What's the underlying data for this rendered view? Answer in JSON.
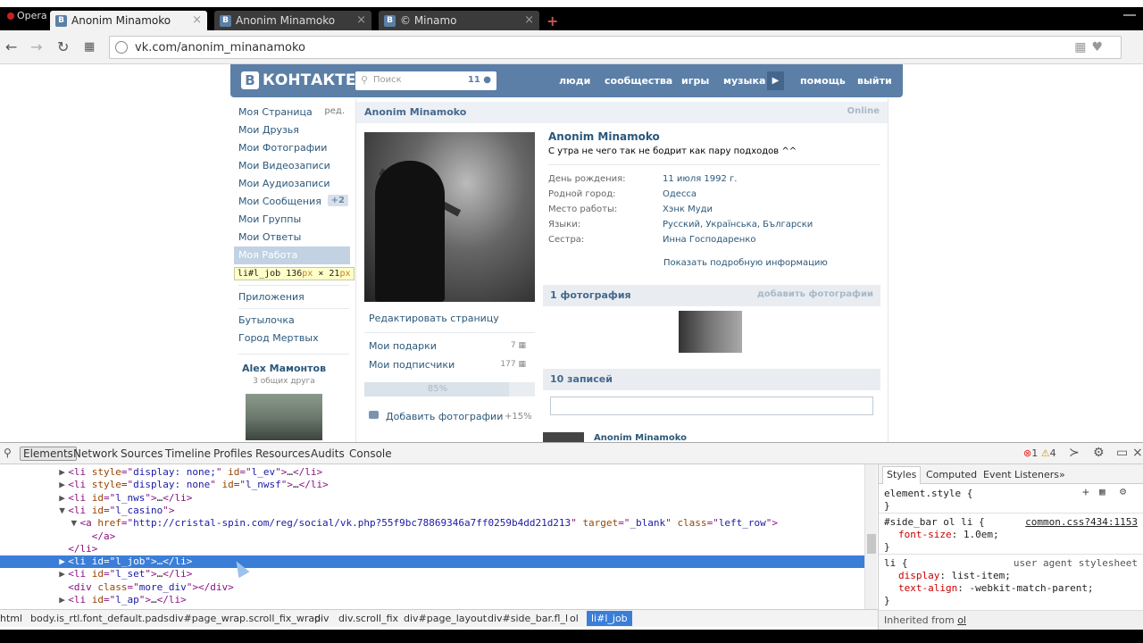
{
  "browser": {
    "opera_label": "Opera",
    "tabs": [
      {
        "title": "Anonim Minamoko",
        "favicon": "В"
      },
      {
        "title": "Anonim Minamoko",
        "favicon": "В"
      },
      {
        "title": "© Minamo",
        "favicon": "В"
      }
    ],
    "url": "vk.com/anonim_minanamoko"
  },
  "vk": {
    "logo": "КОНТАКТЕ",
    "logo_letter": "В",
    "search_placeholder": "Поиск",
    "search_count": "11",
    "menu": [
      "люди",
      "сообщества",
      "игры",
      "музыка",
      "помощь",
      "выйти"
    ],
    "sidebar": [
      {
        "label": "Моя Страница",
        "extra": "ред."
      },
      {
        "label": "Мои Друзья"
      },
      {
        "label": "Мои Фотографии"
      },
      {
        "label": "Мои Видеозаписи"
      },
      {
        "label": "Мои Аудиозаписи"
      },
      {
        "label": "Мои Сообщения",
        "badge": "+2"
      },
      {
        "label": "Мои Группы"
      },
      {
        "label": "Мои Ответы"
      },
      {
        "label": "Моя Работа"
      },
      {
        "label": "Приложения"
      },
      {
        "label": "Бутылочка"
      },
      {
        "label": "Город Мертвых"
      }
    ],
    "tooltip": {
      "sel": "li#l_job",
      "w": "136",
      "h": "21",
      "unit": "px",
      "times": "×"
    },
    "friend": {
      "name": "Alex Мамонтов",
      "sub": "3 общих друга"
    },
    "profile": {
      "header_name": "Anonim Minamoko",
      "online": "Online",
      "name": "Anonim Minamoko",
      "status": "С утра не чего так не бодрит как пару подходов ^^",
      "info": [
        {
          "label": "День рождения:",
          "value": "11 июля 1992 г."
        },
        {
          "label": "Родной город:",
          "value": "Одесса"
        },
        {
          "label": "Место работы:",
          "value": "Хэнк Муди"
        },
        {
          "label": "Языки:",
          "value": "Русский, Українська, Български"
        },
        {
          "label": "Сестра:",
          "value": "Инна Господаренко"
        }
      ],
      "more_info": "Показать подробную информацию",
      "edit_page": "Редактировать страницу",
      "gifts": {
        "label": "Мои подарки",
        "count": "7"
      },
      "subs": {
        "label": "Мои подписчики",
        "count": "177"
      },
      "progress_text": "85%",
      "progress_value": 0.85,
      "add_photos": "Добавить фотографии",
      "add_photos_pct": "+15%",
      "photos_header": "1 фотография",
      "add_photo_link": "добавить фотографии",
      "wall_header": "10 записей",
      "wall_author": "Anonim Minamoko"
    }
  },
  "devtools": {
    "tabs": [
      "Elements",
      "Network",
      "Sources",
      "Timeline",
      "Profiles",
      "Resources",
      "Audits",
      "Console"
    ],
    "errors": "1",
    "warnings": "4",
    "code_lines": [
      {
        "tri": "▶",
        "indent": "            ",
        "parts": [
          [
            "tag",
            "<li "
          ],
          [
            "an",
            "style"
          ],
          [
            "tag",
            "=\""
          ],
          [
            "av",
            "display: none;"
          ],
          [
            "tag",
            "\" "
          ],
          [
            "an",
            "id"
          ],
          [
            "tag",
            "=\""
          ],
          [
            "av",
            "l_ev"
          ],
          [
            "tag",
            "\">"
          ],
          [
            "tx",
            "…"
          ],
          [
            "tag",
            "</li>"
          ]
        ]
      },
      {
        "tri": "▶",
        "indent": "            ",
        "parts": [
          [
            "tag",
            "<li "
          ],
          [
            "an",
            "style"
          ],
          [
            "tag",
            "=\""
          ],
          [
            "av",
            "display: none"
          ],
          [
            "tag",
            "\" "
          ],
          [
            "an",
            "id"
          ],
          [
            "tag",
            "=\""
          ],
          [
            "av",
            "l_nwsf"
          ],
          [
            "tag",
            "\">"
          ],
          [
            "tx",
            "…"
          ],
          [
            "tag",
            "</li>"
          ]
        ]
      },
      {
        "tri": "▶",
        "indent": "            ",
        "parts": [
          [
            "tag",
            "<li "
          ],
          [
            "an",
            "id"
          ],
          [
            "tag",
            "=\""
          ],
          [
            "av",
            "l_nws"
          ],
          [
            "tag",
            "\">"
          ],
          [
            "tx",
            "…"
          ],
          [
            "tag",
            "</li>"
          ]
        ]
      },
      {
        "tri": "▼",
        "indent": "            ",
        "parts": [
          [
            "tag",
            "<li "
          ],
          [
            "an",
            "id"
          ],
          [
            "tag",
            "=\""
          ],
          [
            "av",
            "l_casino"
          ],
          [
            "tag",
            "\">"
          ]
        ]
      },
      {
        "tri": "▼",
        "indent": "              ",
        "parts": [
          [
            "tag",
            "<a "
          ],
          [
            "an",
            "href"
          ],
          [
            "tag",
            "=\""
          ],
          [
            "av",
            "http://cristal-spin.com/reg/social/vk.php?55f9bc78869346a7ff0259b4dd21d213"
          ],
          [
            "tag",
            "\" "
          ],
          [
            "an",
            "target"
          ],
          [
            "tag",
            "=\""
          ],
          [
            "av",
            "_blank"
          ],
          [
            "tag",
            "\" "
          ],
          [
            "an",
            "class"
          ],
          [
            "tag",
            "=\""
          ],
          [
            "av",
            "left_row"
          ],
          [
            "tag",
            "\">"
          ]
        ]
      },
      {
        "tri": "",
        "indent": "                ",
        "parts": [
          [
            "tag",
            "</a>"
          ]
        ]
      },
      {
        "tri": "",
        "indent": "            ",
        "parts": [
          [
            "tag",
            "</li>"
          ]
        ]
      },
      {
        "tri": "▶",
        "indent": "            ",
        "sel": true,
        "parts": [
          [
            "tag",
            "<li "
          ],
          [
            "an",
            "id"
          ],
          [
            "tag",
            "=\""
          ],
          [
            "av",
            "l_job"
          ],
          [
            "tag",
            "\">"
          ],
          [
            "tx",
            "…"
          ],
          [
            "tag",
            "</li>"
          ]
        ]
      },
      {
        "tri": "▶",
        "indent": "            ",
        "parts": [
          [
            "tag",
            "<li "
          ],
          [
            "an",
            "id"
          ],
          [
            "tag",
            "=\""
          ],
          [
            "av",
            "l_set"
          ],
          [
            "tag",
            "\">"
          ],
          [
            "tx",
            "…"
          ],
          [
            "tag",
            "</li>"
          ]
        ]
      },
      {
        "tri": "",
        "indent": "            ",
        "parts": [
          [
            "tag",
            "<div "
          ],
          [
            "an",
            "class"
          ],
          [
            "tag",
            "=\""
          ],
          [
            "av",
            "more_div"
          ],
          [
            "tag",
            "\">"
          ],
          [
            "tag",
            "</div>"
          ]
        ]
      },
      {
        "tri": "▶",
        "indent": "            ",
        "parts": [
          [
            "tag",
            "<li "
          ],
          [
            "an",
            "id"
          ],
          [
            "tag",
            "=\""
          ],
          [
            "av",
            "l_ap"
          ],
          [
            "tag",
            "\">"
          ],
          [
            "tx",
            "…"
          ],
          [
            "tag",
            "</li>"
          ]
        ]
      }
    ],
    "styles_tabs": [
      "Styles",
      "Computed",
      "Event Listeners",
      "»"
    ],
    "rules": {
      "element_style": "element.style {",
      "rule1_sel": "#side_bar ol li {",
      "rule1_src": "common.css?434:1153",
      "rule1_prop": "font-size",
      "rule1_val": "1.0em;",
      "rule2_sel": "li {",
      "rule2_src": "user agent stylesheet",
      "rule2_p1": "display",
      "rule2_v1": "list-item;",
      "rule2_p2": "text-align",
      "rule2_v2": "-webkit-match-parent;",
      "close": "}",
      "inherited_label": "Inherited from",
      "inherited_el": "ol"
    },
    "crumbs": [
      "html",
      "body.is_rtl.font_default.pads",
      "div#page_wrap.scroll_fix_wrap",
      "div",
      "div.scroll_fix",
      "div#page_layout",
      "div#side_bar.fl_l",
      "ol",
      "li#l_job"
    ]
  }
}
